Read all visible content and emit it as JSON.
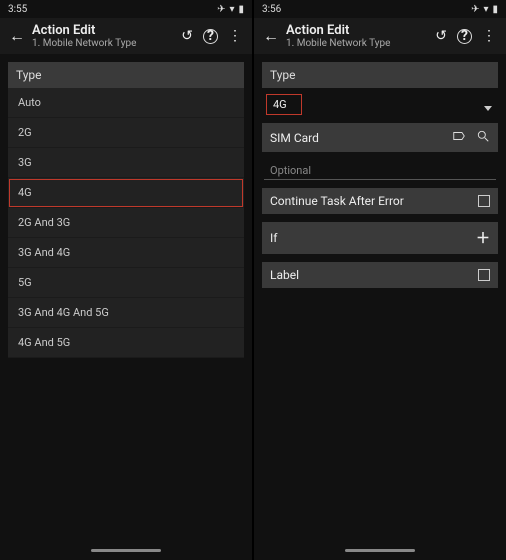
{
  "left": {
    "time": "3:55",
    "title": "Action Edit",
    "subtitle": "1. Mobile Network Type",
    "type_header": "Type",
    "options": [
      "Auto",
      "2G",
      "3G",
      "4G",
      "2G And 3G",
      "3G And 4G",
      "5G",
      "3G And 4G And 5G",
      "4G And 5G"
    ],
    "highlighted": "4G"
  },
  "right": {
    "time": "3:56",
    "title": "Action Edit",
    "subtitle": "1. Mobile Network Type",
    "type_header": "Type",
    "type_value": "4G",
    "sim_header": "SIM Card",
    "optional": "Optional",
    "continue_label": "Continue Task After Error",
    "if_label": "If",
    "label_label": "Label"
  }
}
